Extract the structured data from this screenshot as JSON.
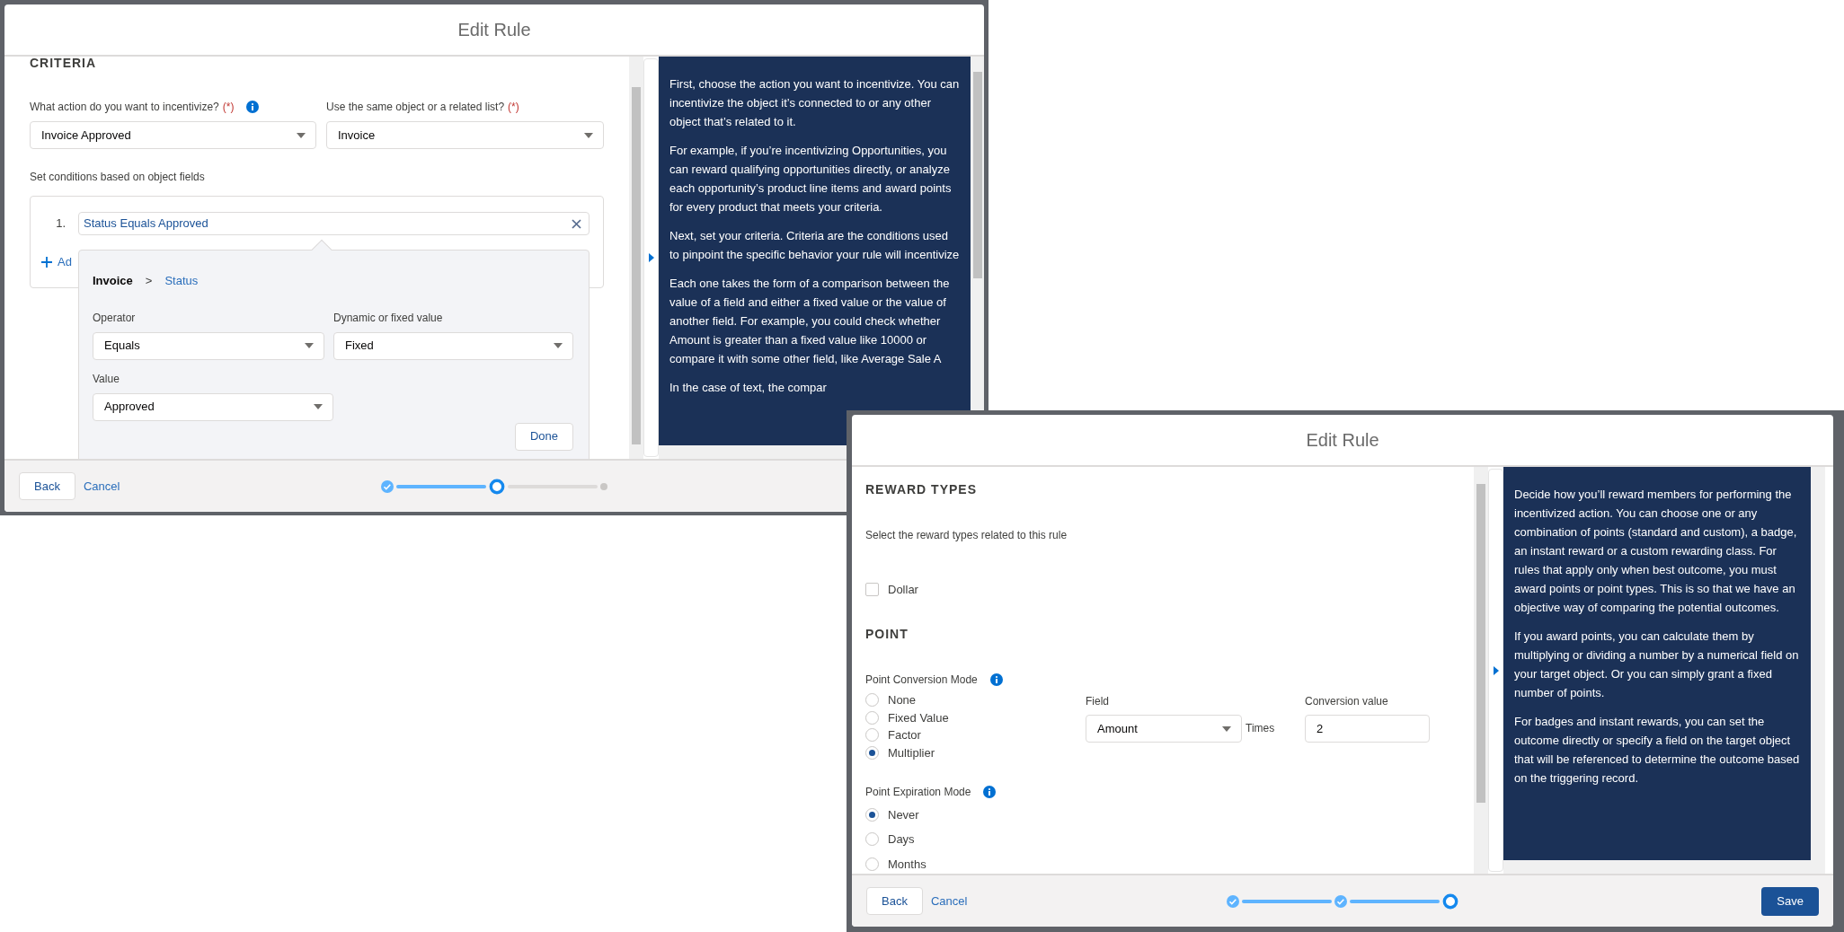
{
  "windows": [
    {
      "kind": "criteria",
      "title": "Edit Rule",
      "section_title": "CRITERIA",
      "action": {
        "label": "What action do you want to incentivize?",
        "required": "(*)",
        "value": "Invoice Approved"
      },
      "object": {
        "label": "Use the same object or a related list?",
        "required": "(*)",
        "value": "Invoice"
      },
      "conditions_label": "Set conditions based on object fields",
      "conditions": [
        {
          "number": "1.",
          "text": "Status Equals Approved"
        }
      ],
      "add_link": "Ad",
      "popover": {
        "object": "Invoice",
        "separator": ">",
        "field": "Status",
        "operator": {
          "label": "Operator",
          "value": "Equals"
        },
        "value_type": {
          "label": "Dynamic or fixed value",
          "value": "Fixed"
        },
        "value": {
          "label": "Value",
          "value": "Approved"
        },
        "done": "Done"
      },
      "help": [
        "First, choose the action you want to incentivize. You can incentivize the object it’s connected to or any other object that’s related to it.",
        "For example, if you’re incentivizing Opportunities, you can reward qualifying opportunities directly, or analyze each opportunity’s product line items and award points for every product that meets your criteria.",
        "Next, set your criteria. Criteria are the conditions used to pinpoint the specific behavior your rule will incentivize",
        "Each one takes the form of a comparison between the value of a field and either a fixed value or the value of another field. For example, you could check whether Amount is greater than a fixed value like 10000 or compare it with some other field, like Average Sale A",
        "In the case of text, the compar"
      ],
      "footer": {
        "back": "Back",
        "cancel": "Cancel",
        "steps": [
          {
            "kind": "done"
          },
          {
            "kind": "current"
          },
          {
            "kind": "todo"
          }
        ]
      }
    },
    {
      "kind": "rewards",
      "title": "Edit Rule",
      "section_title": "REWARD TYPES",
      "hint": "Select the reward types related to this rule",
      "reward_types": [
        {
          "label": "Dollar",
          "checked": false
        }
      ],
      "point_title": "POINT",
      "conversion": {
        "label": "Point Conversion Mode",
        "options": [
          {
            "label": "None",
            "selected": false
          },
          {
            "label": "Fixed Value",
            "selected": false
          },
          {
            "label": "Factor",
            "selected": false
          },
          {
            "label": "Multiplier",
            "selected": true
          }
        ],
        "field": {
          "label": "Field",
          "value": "Amount"
        },
        "times": "Times",
        "conversion_value": {
          "label": "Conversion value",
          "value": "2"
        }
      },
      "expiration": {
        "label": "Point Expiration Mode",
        "options": [
          {
            "label": "Never",
            "selected": true
          },
          {
            "label": "Days",
            "selected": false
          },
          {
            "label": "Months",
            "selected": false
          }
        ]
      },
      "help": [
        "Decide how you’ll reward members for performing the incentivized action. You can choose one or any combination of points (standard and custom), a badge, an instant reward or a custom rewarding class. For rules that apply only when best outcome, you must award points or point types. This is so that we have an objective way of comparing the potential outcomes.",
        "If you award points, you can calculate them by multiplying or dividing a number by a numerical field on your target object. Or you can simply grant a fixed number of points.",
        "For badges and instant rewards, you can set the outcome directly or specify a field on the target object that will be referenced to determine the outcome based on the triggering record."
      ],
      "footer": {
        "back": "Back",
        "cancel": "Cancel",
        "save": "Save",
        "steps": [
          {
            "kind": "done"
          },
          {
            "kind": "done"
          },
          {
            "kind": "current"
          }
        ]
      }
    }
  ]
}
